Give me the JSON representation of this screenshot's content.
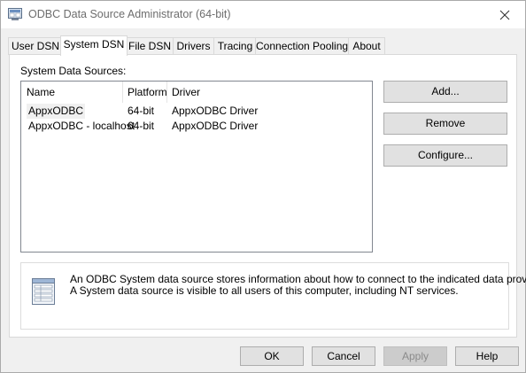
{
  "window": {
    "title": "ODBC Data Source Administrator (64-bit)"
  },
  "tabs": [
    {
      "label": "User DSN"
    },
    {
      "label": "System DSN",
      "active": true
    },
    {
      "label": "File DSN"
    },
    {
      "label": "Drivers"
    },
    {
      "label": "Tracing"
    },
    {
      "label": "Connection Pooling"
    },
    {
      "label": "About"
    }
  ],
  "panel": {
    "group_label": "System Data Sources:",
    "columns": [
      "Name",
      "Platform",
      "Driver"
    ],
    "rows": [
      {
        "name": "AppxODBC",
        "platform": "64-bit",
        "driver": "AppxODBC Driver",
        "selected": true
      },
      {
        "name": "AppxODBC - localhost",
        "platform": "64-bit",
        "driver": "AppxODBC Driver"
      }
    ],
    "buttons": {
      "add": "Add...",
      "remove": "Remove",
      "configure": "Configure..."
    },
    "info": {
      "line1": "An ODBC System data source stores information about how to connect to the indicated data provider.",
      "line2": "A System data source is visible to all users of this computer, including NT services."
    }
  },
  "footer": {
    "ok": "OK",
    "cancel": "Cancel",
    "apply": "Apply",
    "help": "Help"
  },
  "colors": {
    "selection": "#f0f0f0",
    "button_face": "#e1e1e1",
    "button_border": "#adadad",
    "disabled_text": "#8b8b8b"
  }
}
